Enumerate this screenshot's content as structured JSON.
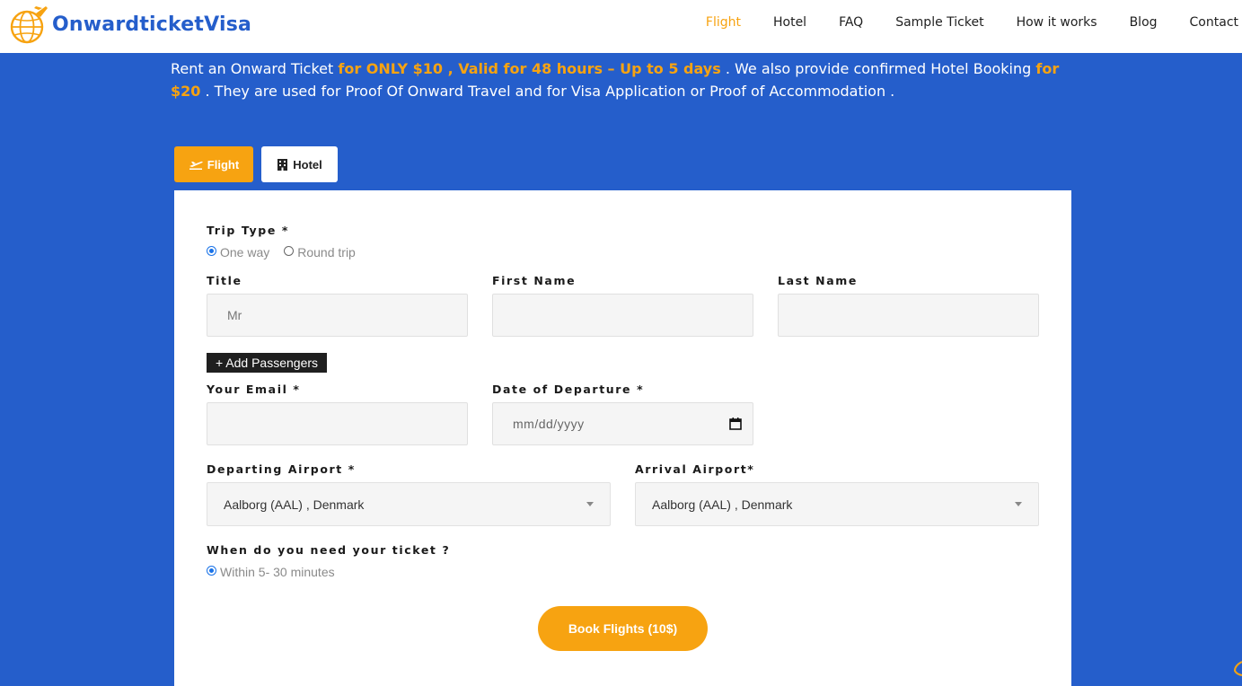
{
  "brand": {
    "name": "OnwardticketVisa",
    "accent": "#f7a311",
    "primary": "#255ecb"
  },
  "nav": {
    "items": [
      {
        "label": "Flight",
        "active": true
      },
      {
        "label": "Hotel"
      },
      {
        "label": "FAQ"
      },
      {
        "label": "Sample Ticket"
      },
      {
        "label": "How it works"
      },
      {
        "label": "Blog"
      },
      {
        "label": "Contact"
      }
    ]
  },
  "intro": {
    "p1": "Rent an Onward Ticket ",
    "h1": "for ONLY $10 , Valid for 48 hours – Up to 5 days",
    "p2": " . We also provide confirmed Hotel Booking ",
    "h2": "for $20",
    "p3": " . They are used for Proof Of Onward Travel and for Visa Application or Proof of Accommodation ."
  },
  "tabs": {
    "flight": "Flight",
    "hotel": "Hotel"
  },
  "form": {
    "trip_type_label": "Trip Type *",
    "trip_options": [
      "One way",
      "Round trip"
    ],
    "title_label": "Title",
    "title_value": "Mr",
    "first_name_label": "First Name",
    "last_name_label": "Last Name",
    "add_passengers": "+ Add Passengers",
    "email_label": "Your Email *",
    "departure_date_label": "Date of Departure *",
    "date_placeholder": "mm/dd/yyyy",
    "departing_label": "Departing Airport *",
    "departing_value": "Aalborg (AAL) , Denmark",
    "arrival_label": "Arrival Airport*",
    "arrival_value": "Aalborg (AAL) , Denmark",
    "when_label": "When do you need your ticket ?",
    "when_option": "Within 5- 30 minutes",
    "submit": "Book Flights (10$)"
  },
  "icons": [
    "globe-plane-logo-icon",
    "plane-icon",
    "hotel-icon",
    "calendar-icon",
    "chevron-down-icon"
  ]
}
